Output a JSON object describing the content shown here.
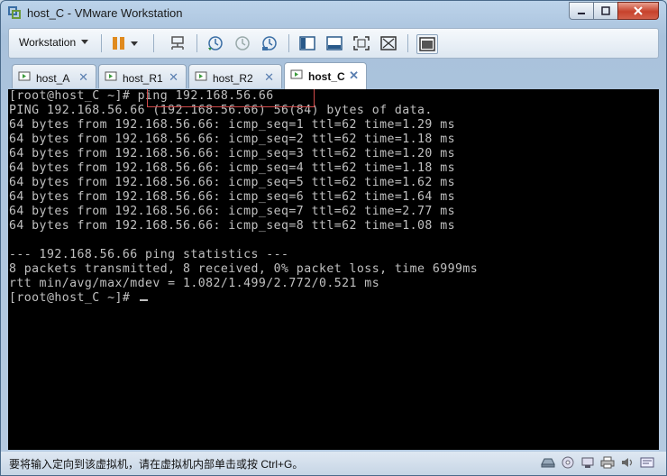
{
  "window": {
    "title": "host_C - VMware Workstation"
  },
  "toolbar": {
    "workstation_label": "Workstation"
  },
  "tabs": [
    {
      "label": "host_A",
      "active": false
    },
    {
      "label": "host_R1",
      "active": false
    },
    {
      "label": "host_R2",
      "active": false
    },
    {
      "label": "host_C",
      "active": true
    }
  ],
  "terminal": {
    "lines": [
      "[root@host_C ~]# ping 192.168.56.66",
      "PING 192.168.56.66 (192.168.56.66) 56(84) bytes of data.",
      "64 bytes from 192.168.56.66: icmp_seq=1 ttl=62 time=1.29 ms",
      "64 bytes from 192.168.56.66: icmp_seq=2 ttl=62 time=1.18 ms",
      "64 bytes from 192.168.56.66: icmp_seq=3 ttl=62 time=1.20 ms",
      "64 bytes from 192.168.56.66: icmp_seq=4 ttl=62 time=1.18 ms",
      "64 bytes from 192.168.56.66: icmp_seq=5 ttl=62 time=1.62 ms",
      "64 bytes from 192.168.56.66: icmp_seq=6 ttl=62 time=1.64 ms",
      "64 bytes from 192.168.56.66: icmp_seq=7 ttl=62 time=2.77 ms",
      "64 bytes from 192.168.56.66: icmp_seq=8 ttl=62 time=1.08 ms",
      "",
      "--- 192.168.56.66 ping statistics ---",
      "8 packets transmitted, 8 received, 0% packet loss, time 6999ms",
      "rtt min/avg/max/mdev = 1.082/1.499/2.772/0.521 ms",
      "[root@host_C ~]# "
    ]
  },
  "statusbar": {
    "text": "要将输入定向到该虚拟机，请在虚拟机内部单击或按 Ctrl+G。"
  },
  "colors": {
    "terminal_bg": "#000000",
    "terminal_fg": "#c0c0c0",
    "highlight": "#d24a4a",
    "close_button": "#c7422c"
  }
}
